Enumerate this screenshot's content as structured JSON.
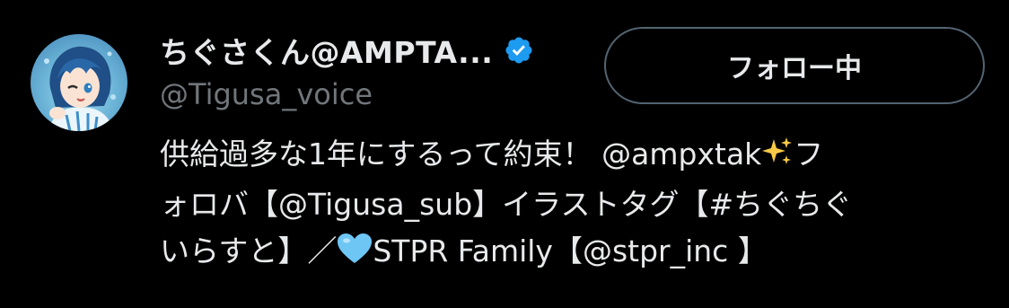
{
  "profile": {
    "display_name": "ちぐさくん@AMPTA...",
    "handle": "@Tigusa_voice",
    "follow_button_label": "フォロー中",
    "bio": {
      "line1_text": "供給過多な1年にするって約束！ @ampxtak",
      "line1_tail": "フ",
      "line2_text": "ォロバ【@Tigusa_sub】イラストタグ【#ちぐちぐ",
      "line3_head": "いらすと】／",
      "line3_tail": "STPR Family【@stpr_inc 】"
    }
  },
  "icons": {
    "verified": "verified-badge-icon",
    "sparkle": "sparkles-emoji-icon",
    "heart": "light-blue-heart-emoji-icon"
  },
  "colors": {
    "background": "#000000",
    "text_primary": "#e7e9ea",
    "text_secondary": "#71767b",
    "button_border": "#536471",
    "verified_blue": "#1d9bf0",
    "heart_blue": "#6ec6f5",
    "sparkle_yellow": "#f7c948"
  }
}
